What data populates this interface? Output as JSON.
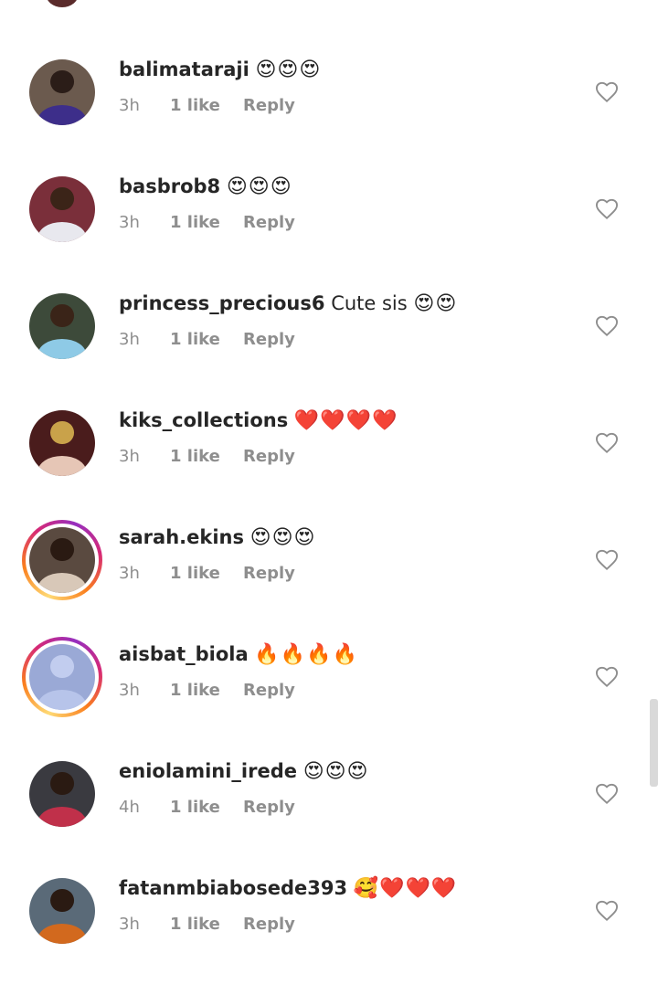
{
  "comments": [
    {
      "username": "balimataraji",
      "text": "",
      "emoji": "😍😍😍",
      "time": "3h",
      "likes": "1 like",
      "reply": "Reply",
      "story": false,
      "colors": {
        "bg": "#6b5a4e",
        "head": "#2b1d18",
        "body": "#3d2e8a"
      }
    },
    {
      "username": "basbrob8",
      "text": "",
      "emoji": "😍😍😍",
      "time": "3h",
      "likes": "1 like",
      "reply": "Reply",
      "story": false,
      "colors": {
        "bg": "#7a2f3a",
        "head": "#3b2418",
        "body": "#e8e8ee"
      }
    },
    {
      "username": "princess_precious6",
      "text": "Cute sis",
      "emoji": "😍😍",
      "time": "3h",
      "likes": "1 like",
      "reply": "Reply",
      "story": false,
      "colors": {
        "bg": "#3d4a3a",
        "head": "#3a2418",
        "body": "#8ecae6"
      }
    },
    {
      "username": "kiks_collections",
      "text": "",
      "emoji": "❤️❤️❤️❤️",
      "time": "3h",
      "likes": "1 like",
      "reply": "Reply",
      "story": false,
      "colors": {
        "bg": "#4a1c1c",
        "head": "#c9a24a",
        "body": "#e6c6b6"
      }
    },
    {
      "username": "sarah.ekins",
      "text": "",
      "emoji": "😍😍😍",
      "time": "3h",
      "likes": "1 like",
      "reply": "Reply",
      "story": true,
      "colors": {
        "bg": "#5a4a40",
        "head": "#2a1a12",
        "body": "#d8c8b8"
      }
    },
    {
      "username": "aisbat_biola",
      "text": "",
      "emoji": "🔥🔥🔥🔥",
      "time": "3h",
      "likes": "1 like",
      "reply": "Reply",
      "story": true,
      "colors": {
        "bg": "#9aa9d6",
        "head": "#c2cdef",
        "body": "#b7c4ea"
      }
    },
    {
      "username": "eniolamini_irede",
      "text": "",
      "emoji": "😍😍😍",
      "time": "4h",
      "likes": "1 like",
      "reply": "Reply",
      "story": false,
      "colors": {
        "bg": "#3a3a40",
        "head": "#2a1a12",
        "body": "#c0304a"
      }
    },
    {
      "username": "fatanmbiabosede393",
      "text": "",
      "emoji": "🥰❤️❤️❤️",
      "time": "3h",
      "likes": "1 like",
      "reply": "Reply",
      "story": false,
      "colors": {
        "bg": "#5a6a78",
        "head": "#2a1a12",
        "body": "#d2691e"
      }
    }
  ]
}
